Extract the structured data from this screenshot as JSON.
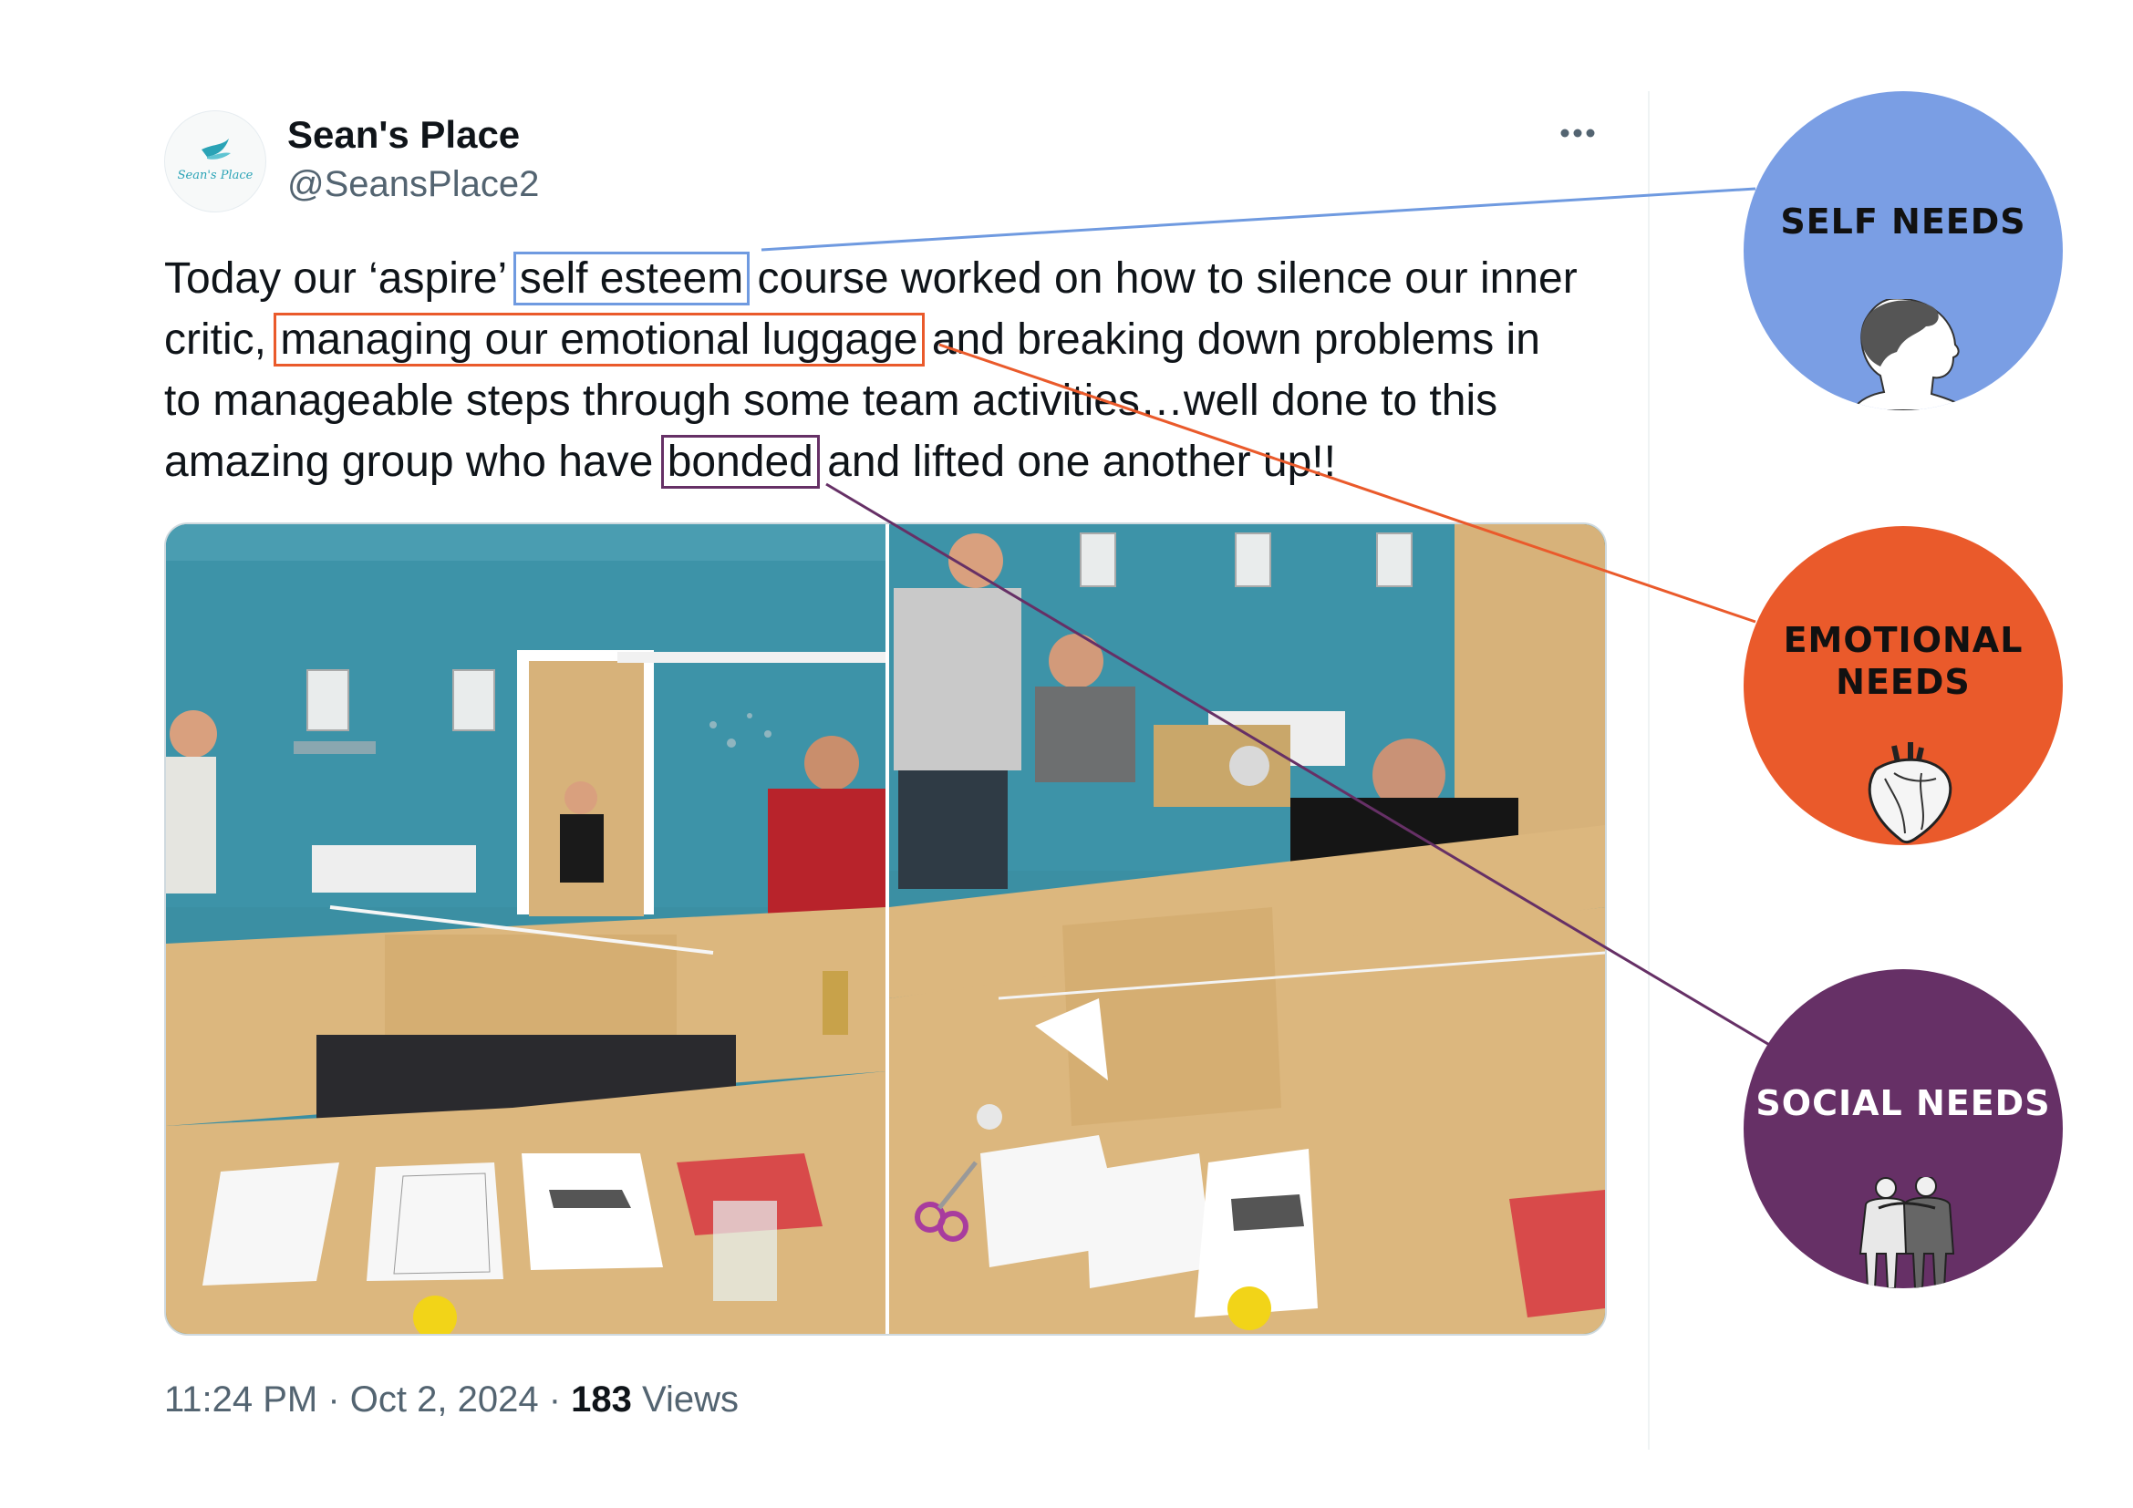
{
  "tweet": {
    "author_name": "Sean's Place",
    "author_handle": "@SeansPlace2",
    "avatar_text": "Sean's Place",
    "text_lines": [
      {
        "before": "Today our ‘aspire’ ",
        "highlight": "self esteem",
        "after": " course worked on how to silence our inner"
      },
      {
        "before": "critic, ",
        "highlight": "managing our emotional luggage",
        "after": " and breaking down problems in"
      },
      {
        "before": "to manageable steps through some team activities…well done to this",
        "highlight": "",
        "after": ""
      },
      {
        "before": "amazing group who have ",
        "highlight": "bonded",
        "after": " and lifted one another up!!"
      }
    ],
    "time": "11:24 PM",
    "date": "Oct 2, 2024",
    "views_count": "183",
    "views_label": "Views",
    "separator": " · "
  },
  "needs": {
    "self": {
      "label": "SELF NEEDS",
      "color": "#7a9ee4",
      "icon": "head-profile-icon"
    },
    "emotional": {
      "label_line1": "EMOTIONAL",
      "label_line2": "NEEDS",
      "color": "#ea5a2b",
      "icon": "anatomical-heart-icon"
    },
    "social": {
      "label": "SOCIAL NEEDS",
      "color": "#663066",
      "icon": "two-people-embracing-icon"
    }
  },
  "colors": {
    "text": "#0f1419",
    "muted": "#536471",
    "border": "#cfd9de"
  }
}
